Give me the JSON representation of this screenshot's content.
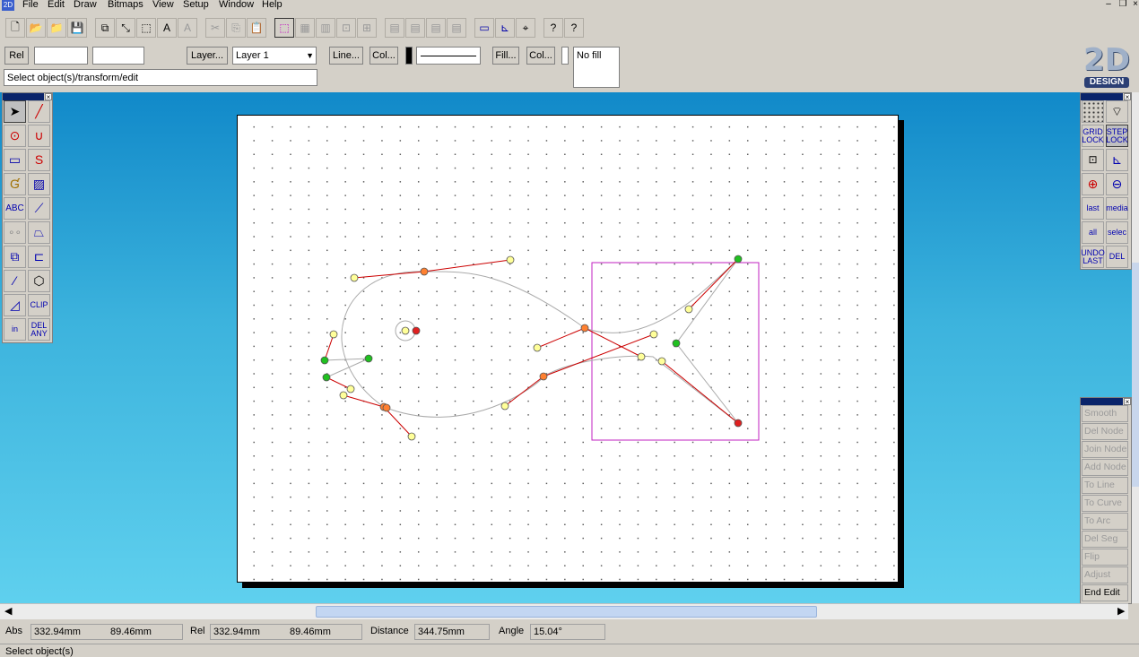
{
  "menu": [
    "File",
    "Edit",
    "Draw",
    "Bitmaps",
    "View",
    "Setup",
    "Window",
    "Help"
  ],
  "toolbar2": {
    "rel_label": "Rel",
    "layer_button": "Layer...",
    "layer_select": "Layer 1",
    "line_button": "Line...",
    "line_col_button": "Col...",
    "fill_button": "Fill...",
    "fill_col_button": "Col...",
    "fill_preview": "No fill"
  },
  "prompt": "Select object(s)/transform/edit",
  "logo": {
    "big": "2D",
    "small": "DESIGN"
  },
  "left_tools": [
    "select",
    "line",
    "circle",
    "arc",
    "rectangle",
    "curve",
    "offset",
    "hatch",
    "text",
    "dimension",
    "points",
    "perspective",
    "transform",
    "array",
    "fill-brush",
    "block",
    "polyline",
    "clip",
    "insert",
    "delete-any"
  ],
  "left_tool_text": {
    "text": "ABC",
    "clip": "CLIP",
    "insert": "in",
    "delete": "DEL ANY"
  },
  "right_tools": {
    "grid_lock": "GRID LOCK",
    "step_lock": "STEP LOCK",
    "zoom_last": "last",
    "zoom_media": "media",
    "zoom_all": "all",
    "zoom_selec": "selec",
    "undo_last": "UNDO LAST",
    "del": "DEL"
  },
  "edit_palette": [
    "Smooth",
    "Del Node",
    "Join Node",
    "Add Node",
    "To Line",
    "To Curve",
    "To Arc",
    "Del Seg",
    "Flip",
    "Adjust",
    "End Edit"
  ],
  "status": {
    "abs_label": "Abs",
    "abs_x": "332.94mm",
    "abs_y": "89.46mm",
    "rel_label": "Rel",
    "rel_x": "332.94mm",
    "rel_y": "89.46mm",
    "distance_label": "Distance",
    "distance": "344.75mm",
    "angle_label": "Angle",
    "angle": "15.04°",
    "message": "Select object(s)"
  },
  "colors": {
    "selection_box": "#c020c0",
    "handle_line": "#cc0000",
    "curve": "#aaaaaa"
  }
}
